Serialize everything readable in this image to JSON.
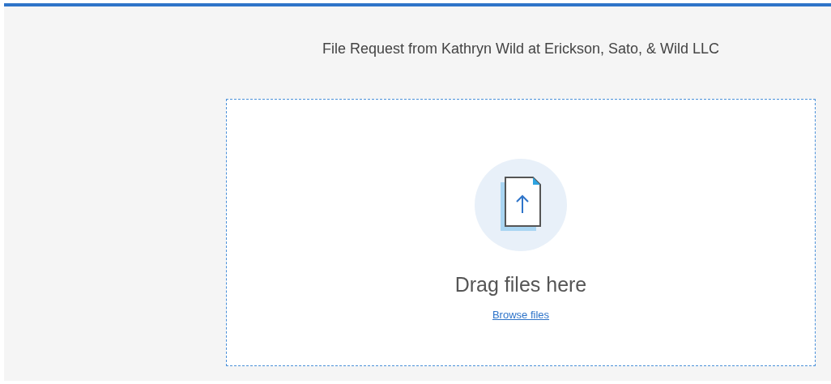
{
  "title": "File Request from Kathryn Wild at Erickson, Sato, & Wild LLC",
  "dropzone": {
    "heading": "Drag files here",
    "link": "Browse files"
  }
}
